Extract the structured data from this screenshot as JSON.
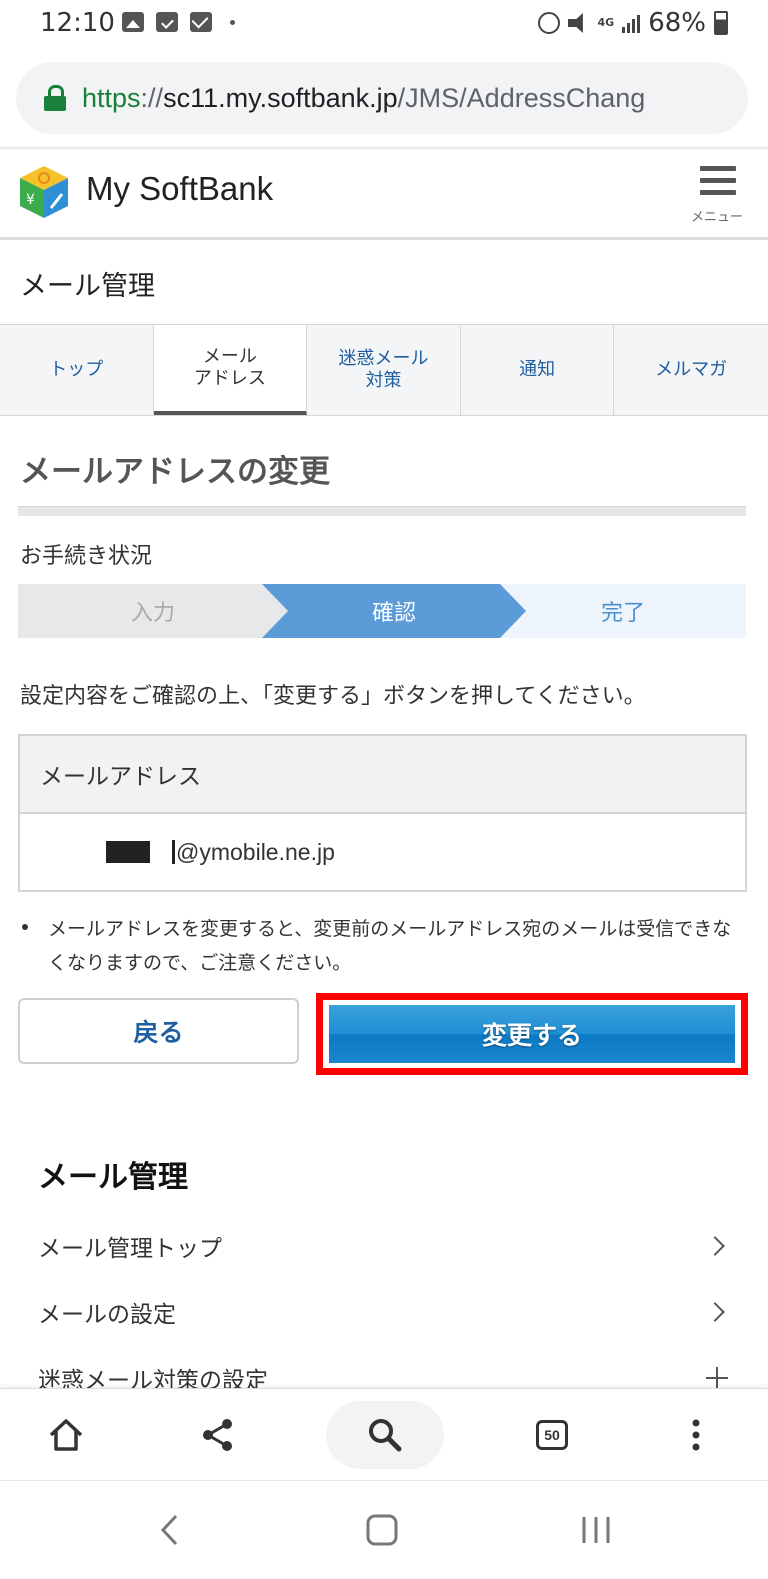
{
  "status_bar": {
    "time": "12:10",
    "battery": "68%",
    "network": "4G"
  },
  "browser": {
    "url_scheme": "https",
    "url_sep": "://",
    "url_host": "sc11.my.softbank.jp",
    "url_path": "/JMS/AddressChang",
    "tab_count": "50"
  },
  "header": {
    "logo_text": "My SoftBank",
    "menu_label": "メニュー"
  },
  "section_title": "メール管理",
  "tabs": [
    {
      "label": "トップ"
    },
    {
      "label": "メール\nアドレス"
    },
    {
      "label": "迷惑メール\n対策"
    },
    {
      "label": "通知"
    },
    {
      "label": "メルマガ"
    }
  ],
  "page_heading": "メールアドレスの変更",
  "status": {
    "label": "お手続き状況",
    "steps": [
      "入力",
      "確認",
      "完了"
    ]
  },
  "instruction": "設定内容をご確認の上、「変更する」ボタンを押してください。",
  "address_table": {
    "header": "メールアドレス",
    "value_domain": "@ymobile.ne.jp"
  },
  "note": "メールアドレスを変更すると、変更前のメールアドレス宛のメールは受信できなくなりますので、ご注意ください。",
  "buttons": {
    "back": "戻る",
    "change": "変更する"
  },
  "nav": {
    "title": "メール管理",
    "items": [
      {
        "label": "メール管理トップ"
      },
      {
        "label": "メールの設定"
      },
      {
        "label": "迷惑メール対策の設定"
      }
    ]
  },
  "colors": {
    "accent_blue": "#1f5fa0",
    "step_active": "#5b9bd8",
    "button_blue": "#1f8ed4",
    "highlight": "#ff0000",
    "secure_green": "#188038"
  }
}
